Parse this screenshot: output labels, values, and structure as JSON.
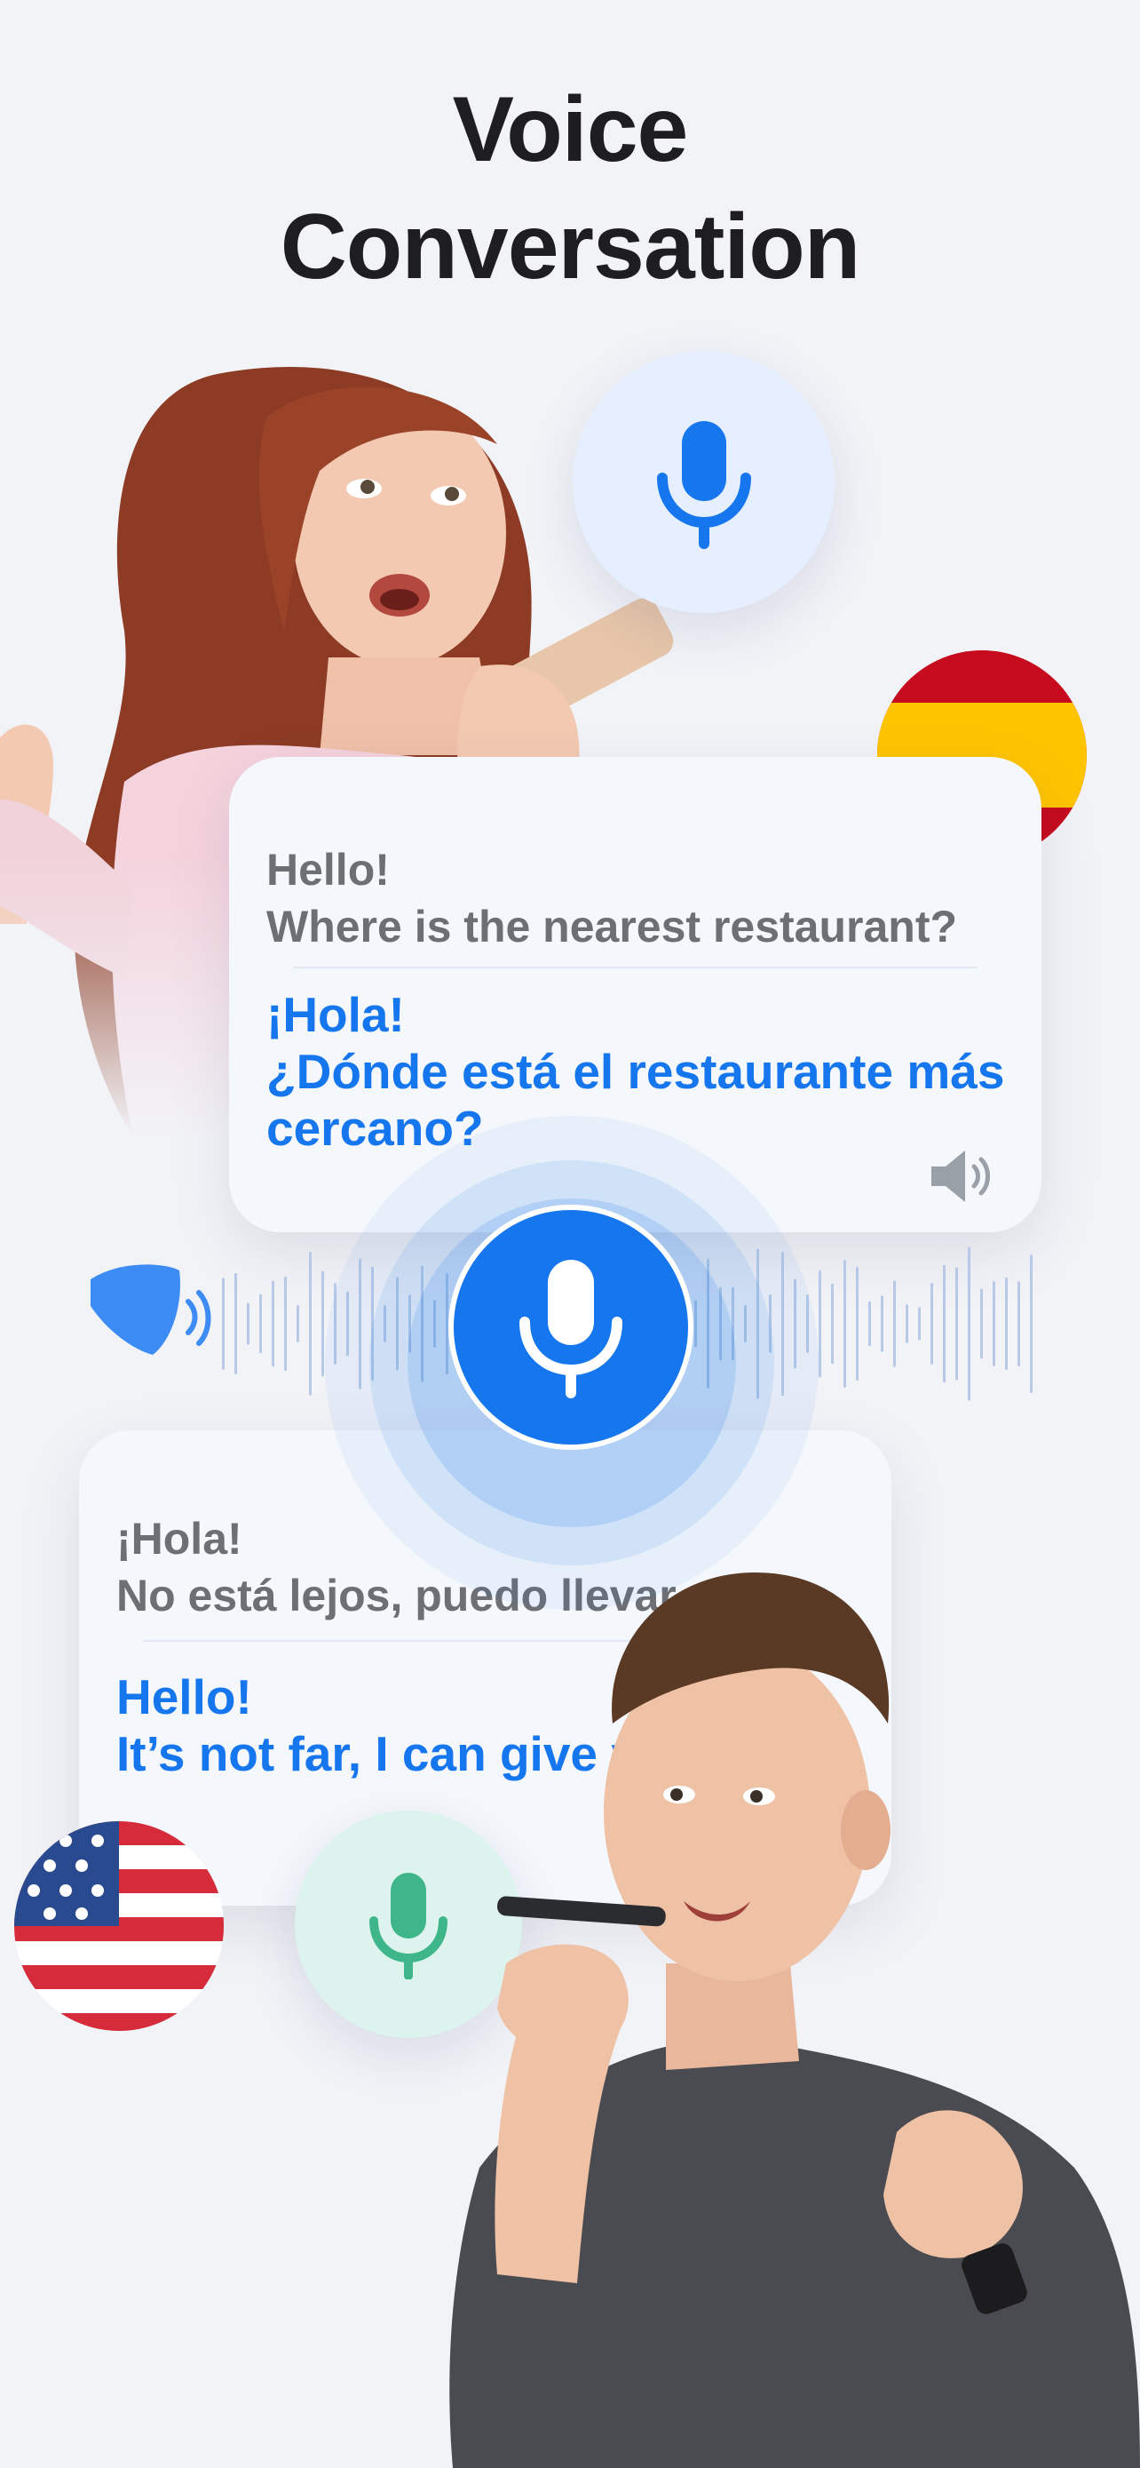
{
  "headline": {
    "line1": "Voice",
    "line2": "Conversation"
  },
  "card_top": {
    "source_lines": [
      "Hello!",
      "Where is the nearest restaurant?"
    ],
    "target_lines": [
      "¡Hola!",
      "¿Dónde está el restaurante más",
      "cercano?"
    ]
  },
  "card_bottom": {
    "source_lines": [
      "¡Hola!",
      "No está lejos, puedo llevar"
    ],
    "target_lines": [
      "Hello!",
      "It’s not far, I can give you"
    ]
  },
  "icons": {
    "top_mic": "microphone-icon",
    "center_mic": "microphone-icon",
    "bottom_mic": "microphone-icon",
    "speaker": "speaker-icon",
    "flag_top": "spain-flag-icon",
    "flag_bottom": "usa-flag-icon"
  },
  "colors": {
    "accent_blue": "#1676ee",
    "accent_green": "#3eb68a",
    "background": "#f2f3f7",
    "source_text": "#6d6f74"
  }
}
